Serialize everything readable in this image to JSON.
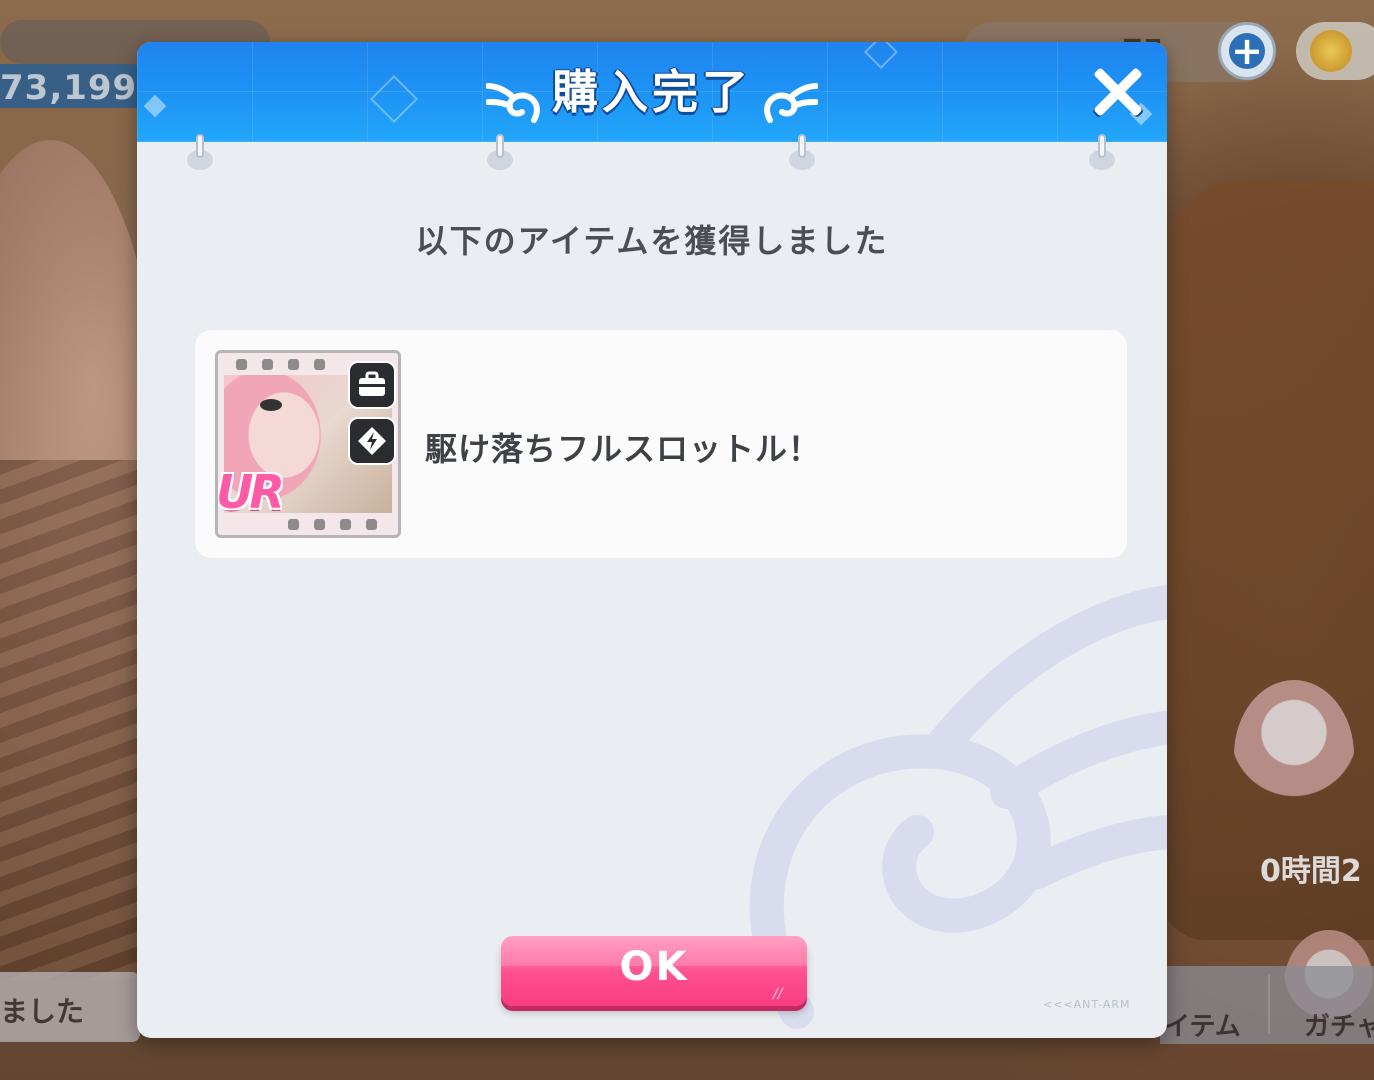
{
  "background": {
    "left_counter": "73,199",
    "right_counter": "75",
    "timer": "0時間2",
    "bottom_left_text": "ました",
    "nav_items": [
      "イテム",
      "ガチャ"
    ]
  },
  "dialog": {
    "title": "購入完了",
    "subtitle": "以下のアイテムを獲得しました",
    "item": {
      "rarity": "UR",
      "name": "駆け落ちフルスロットル！"
    },
    "ok_label": "OK",
    "footer_mark": "<<<ANT-ARM"
  },
  "colors": {
    "header_blue": "#1e95f5",
    "ok_pink": "#ff4f8e",
    "panel_bg": "#eaedf1",
    "card_bg": "#fbfbfb"
  },
  "icons": [
    "wing-icon",
    "close-icon",
    "briefcase-icon",
    "lightning-icon",
    "plus-icon",
    "coin-icon"
  ]
}
